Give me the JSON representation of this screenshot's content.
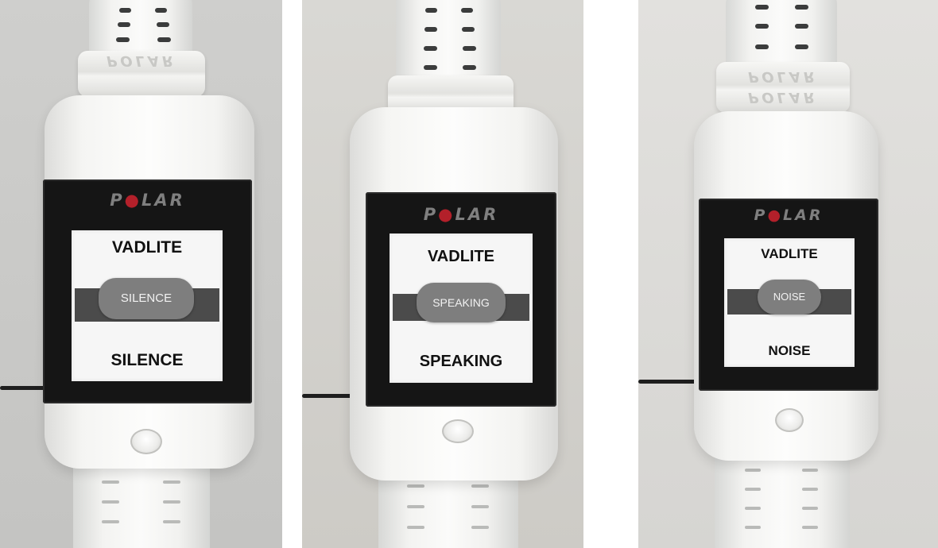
{
  "panels": [
    {
      "logo": "POLAR",
      "keeper_text": "POLAR",
      "title": "VADLITE",
      "popup": "SILENCE",
      "value": "SILENCE"
    },
    {
      "logo": "POLAR",
      "keeper_text": "POLAR",
      "title": "VADLITE",
      "popup": "SPEAKING",
      "value": "SPEAKING"
    },
    {
      "logo": "POLAR",
      "keeper_text": "POLAR",
      "title": "VADLITE",
      "popup": "NOISE",
      "value": "NOISE"
    }
  ],
  "colors": {
    "screen": "#f6f6f6",
    "band": "#4b4b4b",
    "popup": "#7e7e7e",
    "logo_accent": "#b3202a",
    "watch_body": "#f4f4f2"
  }
}
